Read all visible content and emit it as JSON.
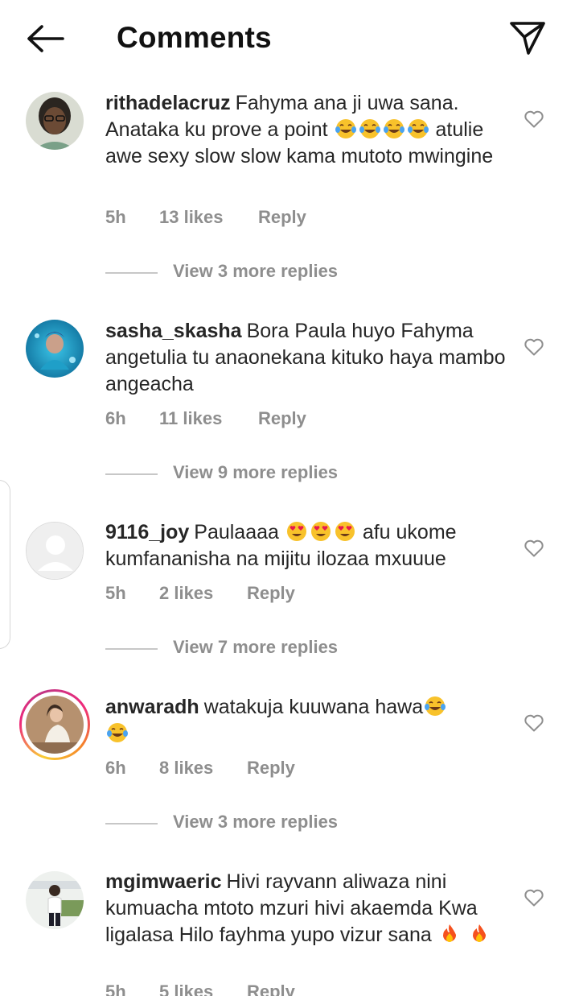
{
  "header": {
    "title": "Comments"
  },
  "comments": [
    {
      "username": "rithadelacruz",
      "text_a": "Fahyma ana ji uwa sana. Anataka ku prove a point ",
      "text_b": " atulie awe sexy slow slow kama mutoto mwingine",
      "emoji": "face-with-tears-of-joy",
      "time": "5h",
      "likes": "13 likes",
      "reply": "Reply",
      "view_replies": "View 3 more replies"
    },
    {
      "username": "sasha_skasha",
      "text": "Bora Paula huyo Fahyma angetulia tu anaonekana kituko haya mambo angeacha",
      "time": "6h",
      "likes": "11 likes",
      "reply": "Reply",
      "view_replies": "View 9 more replies"
    },
    {
      "username": "9116_joy",
      "text_a": "Paulaaaa ",
      "text_b": " afu ukome kumfananisha na mijitu ilozaa mxuuue",
      "emoji": "heart-eyes",
      "time": "5h",
      "likes": "2 likes",
      "reply": "Reply",
      "view_replies": "View 7 more replies"
    },
    {
      "username": "anwaradh",
      "text_a": "watakuja kuuwana hawa",
      "emoji": "face-with-tears-of-joy",
      "time": "6h",
      "likes": "8 likes",
      "reply": "Reply",
      "view_replies": "View 3 more replies"
    },
    {
      "username": "mgimwaeric",
      "text_a": "Hivi rayvann aliwaza nini kumuacha mtoto mzuri hivi akaemda Kwa ligalasa Hilo fayhma yupo vizur sana ",
      "emoji": "fire",
      "time": "5h",
      "likes": "5 likes",
      "reply": "Reply"
    }
  ],
  "colors": {
    "text": "#262626",
    "muted": "#8e8e8e",
    "divider": "#c7c7c7"
  }
}
